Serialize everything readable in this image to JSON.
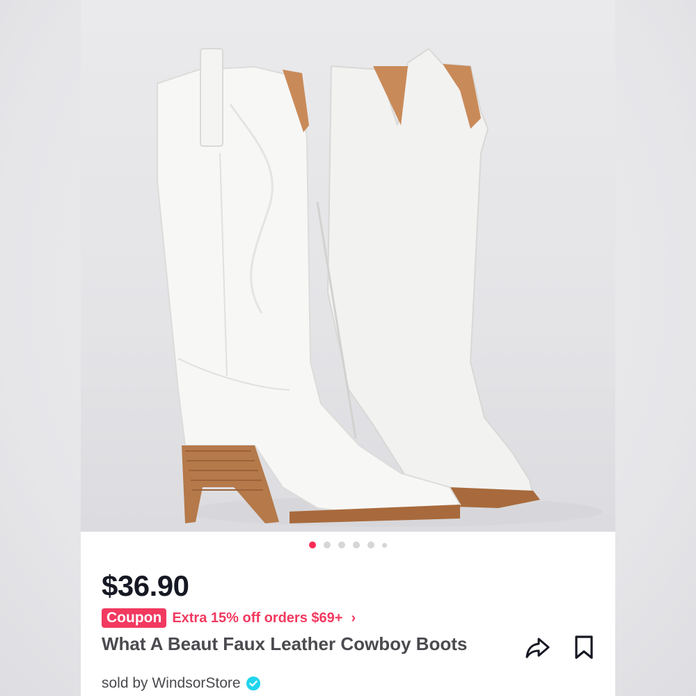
{
  "gallery": {
    "image_alt": "White knee-high cowboy boots with western stitching and stacked wood heels",
    "dots_total": 6,
    "active_index": 0
  },
  "product": {
    "price": "$36.90",
    "coupon_label": "Coupon",
    "coupon_text": "Extra 15% off orders $69+",
    "title": "What A Beaut Faux Leather Cowboy Boots",
    "seller": "sold by WindsorStore"
  },
  "icons": {
    "share": "share-icon",
    "save": "bookmark-icon",
    "verified": "verified-badge-icon",
    "chevron": "chevron-right-icon"
  },
  "colors": {
    "accent": "#fe2c55",
    "coupon": "#f2395f",
    "verified": "#20d5ec"
  }
}
